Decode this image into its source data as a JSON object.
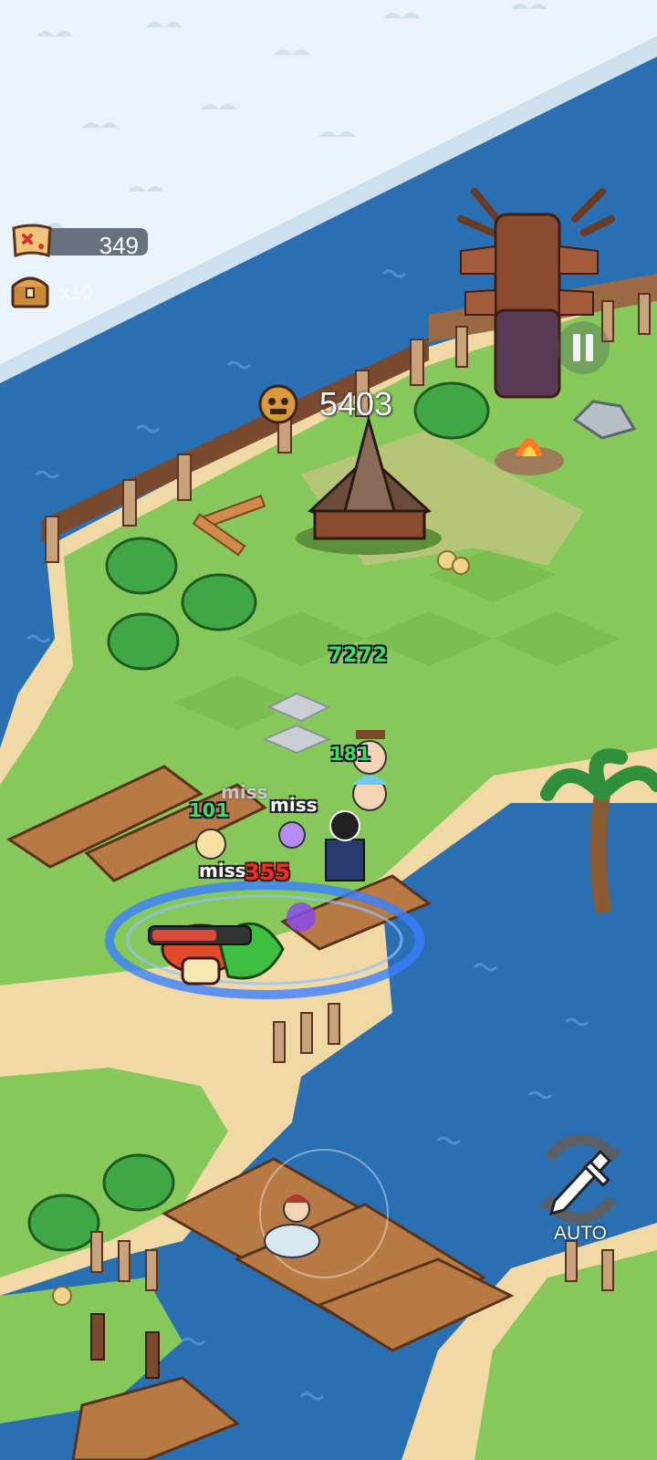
{
  "hud": {
    "map_count": "349",
    "chest_count": "x10",
    "boss_hp": "5403",
    "auto_label": "AUTO"
  },
  "combat_text": {
    "heal_1": "7272",
    "heal_2": "181",
    "heal_3": "101",
    "miss_1": "miss",
    "miss_2": "miss",
    "miss_3": "miss",
    "damage_1": "355"
  },
  "icons": {
    "map": "treasure-map-icon",
    "chest": "treasure-chest-icon",
    "boss": "tiki-mask-icon",
    "pause": "pause-icon",
    "auto": "auto-battle-sword-icon"
  },
  "colors": {
    "water": "#2b6fb3",
    "snow": "#eaf3fb",
    "grass": "#86c95a",
    "sand": "#f1d9a5",
    "heal_text": "#3ee25a",
    "damage_text": "#e8322c"
  }
}
